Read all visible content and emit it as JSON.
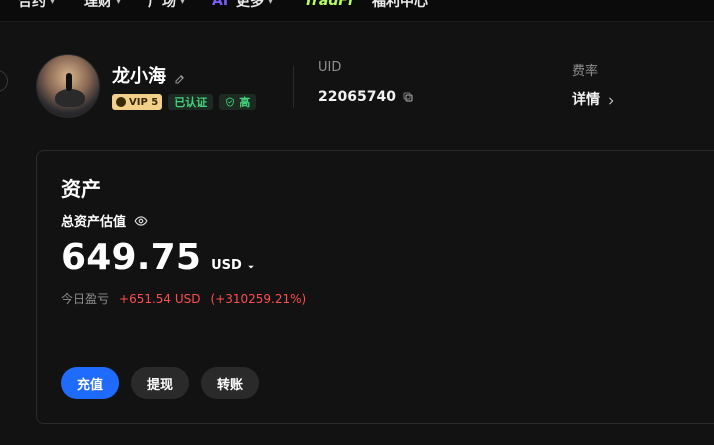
{
  "top_nav": {
    "items": [
      {
        "label": "合约",
        "has_dropdown": true
      },
      {
        "label": "理财",
        "has_dropdown": true
      },
      {
        "label": "广场",
        "has_dropdown": true
      },
      {
        "label": "AI",
        "has_dropdown": false
      },
      {
        "label": "更多",
        "has_dropdown": true
      },
      {
        "label": "TradFi",
        "has_dropdown": false
      },
      {
        "label": "福利中心",
        "has_dropdown": false
      }
    ]
  },
  "profile": {
    "username": "龙小海",
    "vip_label": "VIP 5",
    "verified_label": "已认证",
    "security_label": "高",
    "uid_label": "UID",
    "uid_value": "22065740",
    "fee_label": "费率",
    "fee_link_label": "详情"
  },
  "assets": {
    "title": "资产",
    "estimate_label": "总资产估值",
    "balance": "649.75",
    "currency": "USD",
    "today_pnl_label": "今日盈亏",
    "today_pnl_value": "+651.54 USD",
    "today_pnl_pct": "(+310259.21%)",
    "buttons": {
      "deposit": "充值",
      "withdraw": "提现",
      "transfer": "转账"
    }
  },
  "colors": {
    "bg": "#121212",
    "primary": "#1f6bff",
    "green": "#44d37d",
    "red": "#ff4d4f",
    "vip": "#f3d08a"
  },
  "icons": {
    "edit": "edit-icon",
    "copy": "copy-icon",
    "eye": "eye-icon",
    "shield": "shield-icon",
    "chevron_right": "chevron-right-icon",
    "caret_down": "caret-down-icon"
  }
}
